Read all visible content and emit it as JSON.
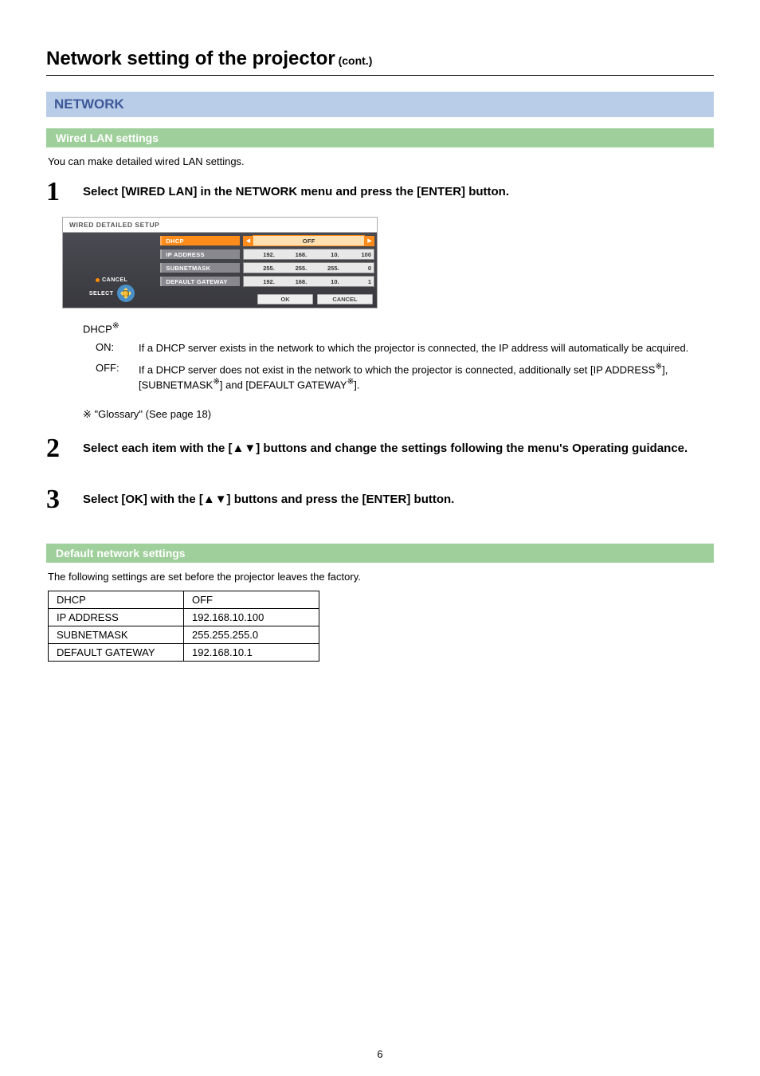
{
  "heading": {
    "title": "Network setting of the projector",
    "cont": " (cont.)"
  },
  "section": "NETWORK",
  "wired": {
    "title": "Wired LAN settings",
    "intro": "You can make detailed wired LAN settings.",
    "step1": {
      "num": "1",
      "text": "Select [WIRED LAN] in the NETWORK menu and press the [ENTER] button."
    },
    "step2": {
      "num": "2",
      "text": "Select each item with the [▲▼] buttons and change the settings following the menu's Operating guidance."
    },
    "step3": {
      "num": "3",
      "text": "Select [OK] with the [▲▼] buttons and press the [ENTER] button."
    }
  },
  "projMenu": {
    "title": "WIRED DETAILED SETUP",
    "items": [
      {
        "label": "DHCP",
        "type": "select",
        "value": "OFF",
        "selected": true
      },
      {
        "label": "IP ADDRESS",
        "type": "ip",
        "segs": [
          "192.",
          "168.",
          "10.",
          "100"
        ]
      },
      {
        "label": "SUBNETMASK",
        "type": "ip",
        "segs": [
          "255.",
          "255.",
          "255.",
          "0"
        ]
      },
      {
        "label": "DEFAULT GATEWAY",
        "type": "ip",
        "segs": [
          "192.",
          "168.",
          "10.",
          "1"
        ]
      }
    ],
    "cancel": "CANCEL",
    "select": "SELECT",
    "ok": "OK",
    "cancelBtn": "CANCEL"
  },
  "dhcp": {
    "title": "DHCP",
    "mark": "※",
    "on": {
      "key": "ON:",
      "text": "If a DHCP server exists in the network to which the projector is connected, the IP address will automatically be acquired."
    },
    "off": {
      "key": "OFF:",
      "text_a": "If a DHCP server does not exist in the network to which the projector is connected, additionally set [IP ADDRESS",
      "text_b": "], [SUBNETMASK",
      "text_c": "] and [DEFAULT GATEWAY",
      "text_d": "]."
    },
    "glossary": "\"Glossary\" (See page 18)"
  },
  "defaults": {
    "title": "Default network settings",
    "intro": "The following settings are set before the projector leaves the factory.",
    "rows": [
      {
        "k": "DHCP",
        "v": "OFF"
      },
      {
        "k": "IP ADDRESS",
        "v": "192.168.10.100"
      },
      {
        "k": "SUBNETMASK",
        "v": "255.255.255.0"
      },
      {
        "k": "DEFAULT GATEWAY",
        "v": "192.168.10.1"
      }
    ]
  },
  "pageNumber": "6"
}
